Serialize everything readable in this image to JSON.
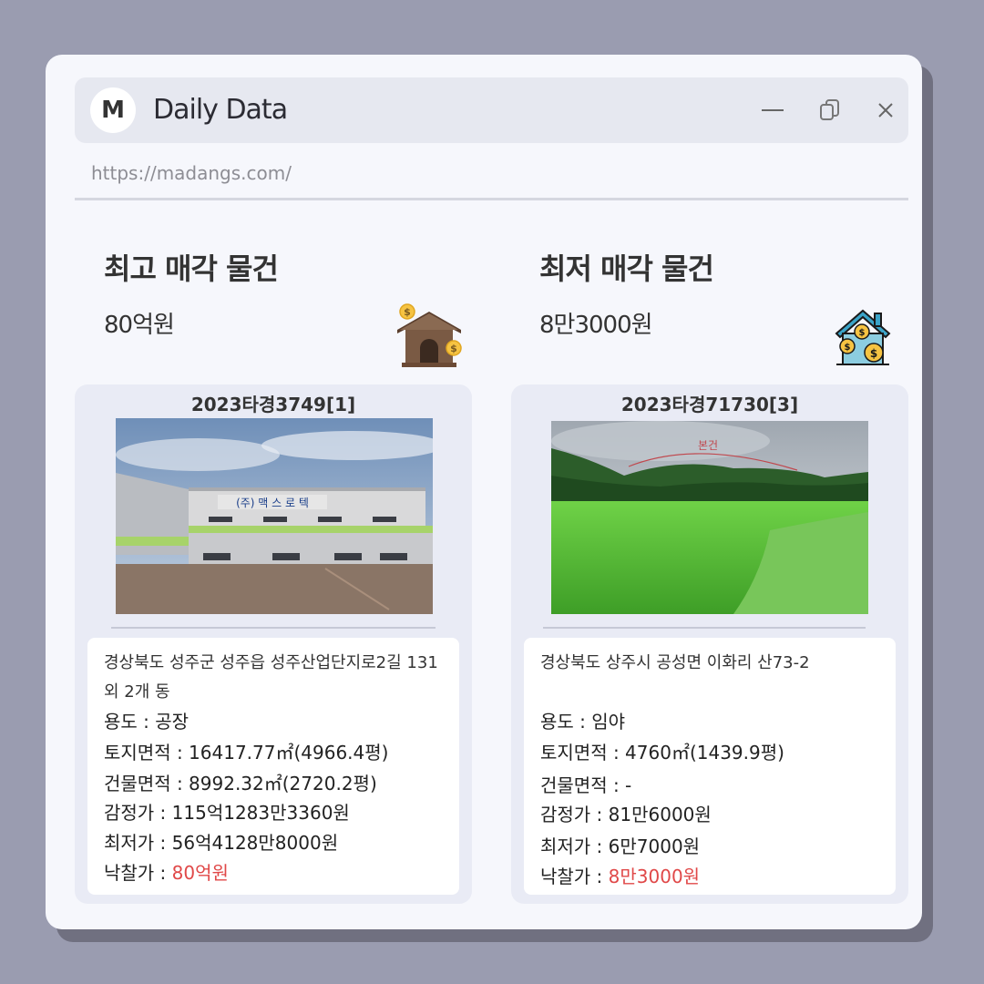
{
  "window": {
    "logo": "M",
    "title": "Daily Data",
    "controls": [
      "minimize-icon",
      "copy-icon",
      "close-icon"
    ]
  },
  "url": "https://madangs.com/",
  "highest": {
    "heading": "최고 매각 물건",
    "price": "80억원",
    "icon": "house-money-icon",
    "case_no": "2023타경3749[1]",
    "photo_sign": "(주) 맥 스 로 텍",
    "address": "경상북도 성주군 성주읍 성주산업단지로2길 131 외 2개 동",
    "usage": "용도 : 공장",
    "land_area": "토지면적 : 16417.77㎡(4966.4평)",
    "building_area": "건물면적 : 8992.32㎡(2720.2평)",
    "appraisal": "감정가 : 115억1283만3360원",
    "minimum": "최저가 : 56억4128만8000원",
    "winning_label": "낙찰가 : ",
    "winning_value": "80억원"
  },
  "lowest": {
    "heading": "최저 매각 물건",
    "price": "8만3000원",
    "icon": "house-coins-icon",
    "case_no": "2023타경71730[3]",
    "photo_label": "본건",
    "address": "경상북도 상주시 공성면 이화리 산73-2",
    "usage": "용도 : 임야",
    "land_area": "토지면적 : 4760㎡(1439.9평)",
    "building_area": "건물면적 : -",
    "appraisal": "감정가 : 81만6000원",
    "minimum": "최저가 : 6만7000원",
    "winning_label": "낙찰가 : ",
    "winning_value": "8만3000원"
  },
  "colors": {
    "background": "#9a9cb0",
    "window": "#f6f7fc",
    "card": "#e9ebf5",
    "accent_red": "#e04848"
  }
}
